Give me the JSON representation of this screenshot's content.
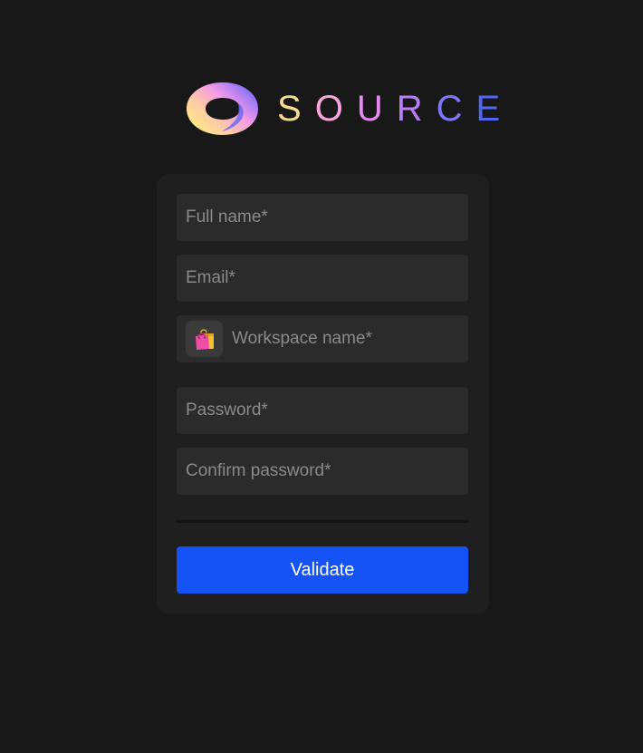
{
  "brand": {
    "name_letters": [
      "S",
      "O",
      "U",
      "R",
      "C",
      "E"
    ],
    "letter_colors": [
      "#f7dc8f",
      "#f6a6dc",
      "#e58af0",
      "#b57ef5",
      "#7f76f7",
      "#4f66f4"
    ]
  },
  "form": {
    "fields": [
      {
        "placeholder": "Full name*",
        "value": ""
      },
      {
        "placeholder": "Email*",
        "value": ""
      },
      {
        "placeholder": "Workspace name*",
        "value": "",
        "icon": "shopping-bags-icon"
      },
      {
        "placeholder": "Password*",
        "value": ""
      },
      {
        "placeholder": "Confirm password*",
        "value": ""
      }
    ],
    "submit_label": "Validate"
  },
  "colors": {
    "background": "#181818",
    "card": "#1f1f1f",
    "field": "#2b2b2b",
    "accent": "#1653f7"
  }
}
